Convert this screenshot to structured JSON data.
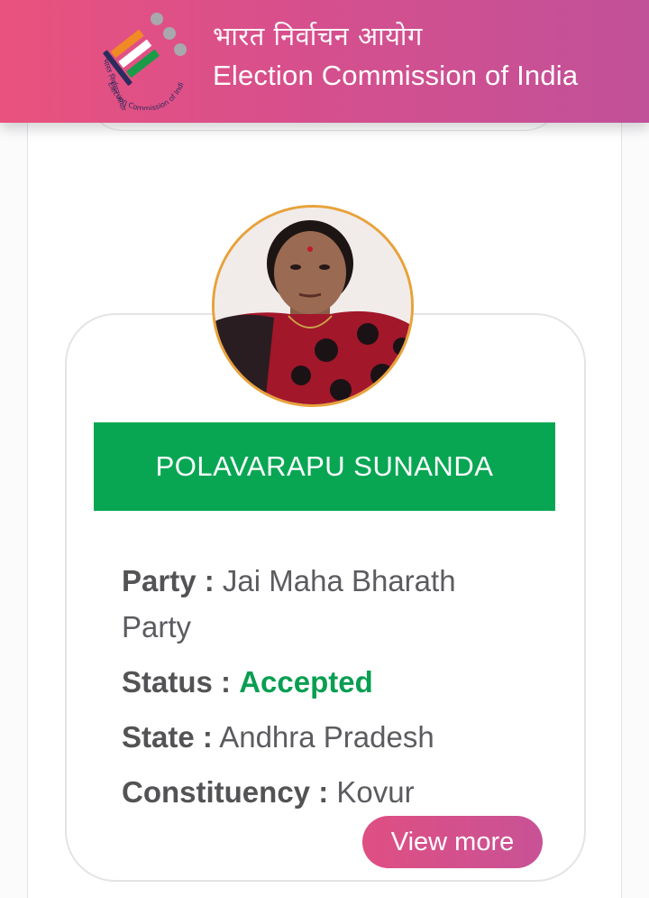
{
  "header": {
    "title_hindi": "भारत निर्वाचन आयोग",
    "title_english": "Election Commission of India",
    "logo_text_hindi": "भारत निर्वाचन आयोग",
    "logo_text_english": "Election Commission of India"
  },
  "candidate": {
    "name": "POLAVARAPU SUNANDA",
    "party_label": "Party :",
    "party": "Jai Maha Bharath Party",
    "status_label": "Status :",
    "status": "Accepted",
    "state_label": "State :",
    "state": "Andhra Pradesh",
    "constituency_label": "Constituency :",
    "constituency": "Kovur"
  },
  "actions": {
    "view_more_label": "View more"
  },
  "colors": {
    "header_gradient_start": "#e9527e",
    "header_gradient_end": "#c15199",
    "name_bar": "#08a653",
    "status_accepted": "#0a9e52",
    "avatar_ring": "#e8a23a"
  }
}
